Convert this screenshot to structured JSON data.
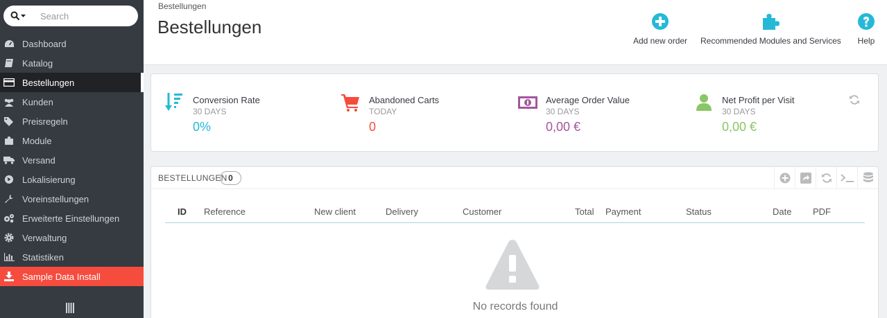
{
  "search": {
    "placeholder": "Search"
  },
  "sidebar": {
    "items": [
      {
        "label": "Dashboard",
        "icon": "dashboard-icon"
      },
      {
        "label": "Katalog",
        "icon": "book-icon"
      },
      {
        "label": "Bestellungen",
        "icon": "credit-card-icon",
        "active": true
      },
      {
        "label": "Kunden",
        "icon": "users-icon"
      },
      {
        "label": "Preisregeln",
        "icon": "tags-icon"
      },
      {
        "label": "Module",
        "icon": "puzzle-icon"
      },
      {
        "label": "Versand",
        "icon": "truck-icon"
      },
      {
        "label": "Lokalisierung",
        "icon": "globe-icon"
      },
      {
        "label": "Voreinstellungen",
        "icon": "wrench-icon"
      },
      {
        "label": "Erweiterte Einstellungen",
        "icon": "cogs-icon"
      },
      {
        "label": "Verwaltung",
        "icon": "gear-icon"
      },
      {
        "label": "Statistiken",
        "icon": "bar-chart-icon"
      },
      {
        "label": "Sample Data Install",
        "icon": "download-icon"
      }
    ]
  },
  "header": {
    "breadcrumb": "Bestellungen",
    "title": "Bestellungen",
    "toolbar": {
      "add_order": "Add new order",
      "modules": "Recommended Modules and Services",
      "help": "Help"
    }
  },
  "kpis": [
    {
      "title": "Conversion Rate",
      "sub": "30 DAYS",
      "value": "0%",
      "color": "#25b9d7",
      "icon": "sort-amount-down-icon"
    },
    {
      "title": "Abandoned Carts",
      "sub": "TODAY",
      "value": "0",
      "color": "#f54c3e",
      "icon": "shopping-cart-icon"
    },
    {
      "title": "Average Order Value",
      "sub": "30 DAYS",
      "value": "0,00 €",
      "color": "#a3569e",
      "icon": "money-icon"
    },
    {
      "title": "Net Profit per Visit",
      "sub": "30 DAYS",
      "value": "0,00 €",
      "color": "#8ac665",
      "icon": "user-icon"
    }
  ],
  "orders": {
    "title": "BESTELLUNGEN",
    "count": "0",
    "columns": [
      "ID",
      "Reference",
      "New client",
      "Delivery",
      "Customer",
      "Total",
      "Payment",
      "Status",
      "Date",
      "PDF"
    ],
    "empty_text": "No records found"
  },
  "colors": {
    "accent": "#25b9d7",
    "sidebar": "#363a41",
    "sample": "#f54c3e"
  }
}
